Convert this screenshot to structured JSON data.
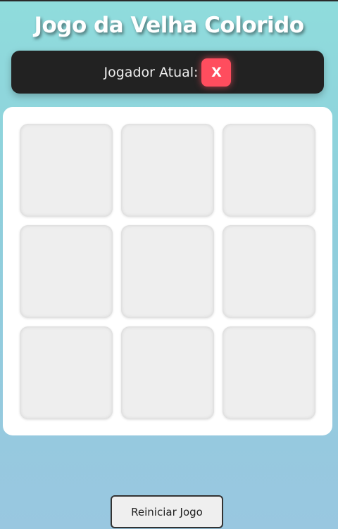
{
  "title": "Jogo da Velha Colorido",
  "status": {
    "label": "Jogador Atual:",
    "current_player": "X",
    "player_color": "#ff4d5e"
  },
  "board": {
    "cells": [
      "",
      "",
      "",
      "",
      "",
      "",
      "",
      "",
      ""
    ]
  },
  "reset_button": {
    "label": "Reiniciar Jogo"
  }
}
